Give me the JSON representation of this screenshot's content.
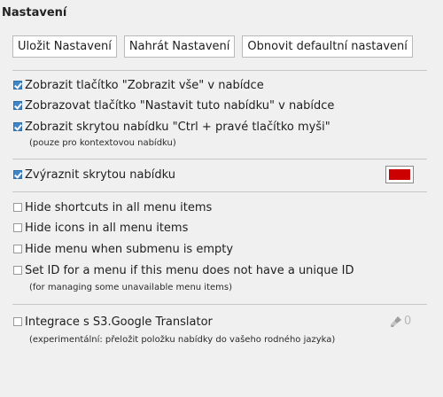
{
  "section_title": "Nastavení",
  "buttons": {
    "save": "Uložit Nastavení",
    "load": "Nahrát Nastavení",
    "reset": "Obnovit defaultní nastavení"
  },
  "options": [
    {
      "label": "Zobrazit tlačítko \"Zobrazit vše\" v nabídce",
      "checked": true
    },
    {
      "label": "Zobrazovat tlačítko \"Nastavit tuto nabídku\" v nabídce",
      "checked": true
    },
    {
      "label": "Zobrazit skrytou nabídku \"Ctrl + pravé tlačítko myši\"",
      "checked": true,
      "note": "(pouze pro kontextovou nabídku)"
    },
    {
      "label": "Zvýraznit skrytou nabídku",
      "checked": true,
      "color": "#cc0000"
    },
    {
      "label": "Hide shortcuts in all menu items",
      "checked": false
    },
    {
      "label": "Hide icons in all menu items",
      "checked": false
    },
    {
      "label": "Hide menu when submenu is empty",
      "checked": false
    },
    {
      "label": "Set ID for a menu if this menu does not have a unique ID",
      "checked": false,
      "note": "(for managing some unavailable menu items)"
    },
    {
      "label": "Integrace s S3.Google Translator",
      "checked": false,
      "note": "(experimentální: přeložit položku nabídky do vašeho rodného jazyka)",
      "count": "0",
      "icon": "brush-icon"
    }
  ]
}
